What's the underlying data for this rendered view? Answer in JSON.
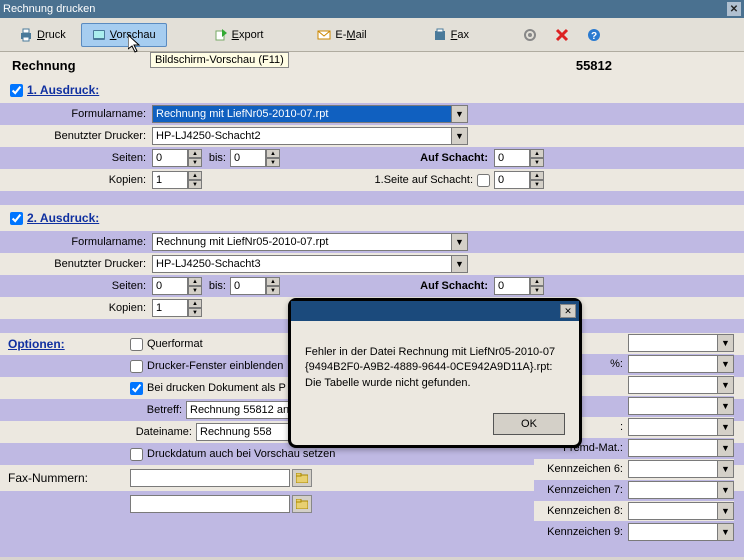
{
  "window": {
    "title": "Rechnung drucken"
  },
  "toolbar": {
    "druck": "Druck",
    "vorschau": "Vorschau",
    "export": "Export",
    "email": "E-Mail",
    "fax": "Fax"
  },
  "tooltip": "Bildschirm-Vorschau (F11)",
  "header": {
    "title": "Rechnung",
    "number": "55812"
  },
  "ausdruck1": {
    "heading": "1. Ausdruck:",
    "formularname_label": "Formularname:",
    "formularname": "Rechnung mit LiefNr05-2010-07.rpt",
    "drucker_label": "Benutzter Drucker:",
    "drucker": "HP-LJ4250-Schacht2",
    "seiten_label": "Seiten:",
    "seiten": "0",
    "bis_label": "bis:",
    "bis": "0",
    "auf_schacht_label": "Auf Schacht:",
    "auf_schacht": "0",
    "kopien_label": "Kopien:",
    "kopien": "1",
    "seite1_label": "1.Seite auf Schacht:",
    "seite1": "0"
  },
  "ausdruck2": {
    "heading": "2. Ausdruck:",
    "formularname_label": "Formularname:",
    "formularname": "Rechnung mit LiefNr05-2010-07.rpt",
    "drucker_label": "Benutzter Drucker:",
    "drucker": "HP-LJ4250-Schacht3",
    "seiten_label": "Seiten:",
    "seiten": "0",
    "bis_label": "bis:",
    "bis": "0",
    "auf_schacht_label": "Auf Schacht:",
    "auf_schacht": "0",
    "kopien_label": "Kopien:",
    "kopien": "1"
  },
  "optionen": {
    "heading": "Optionen:",
    "querformat": "Querformat",
    "drucker_fenster": "Drucker-Fenster einblenden",
    "bei_drucken": "Bei drucken Dokument als P",
    "betreff_label": "Betreff:",
    "betreff": "Rechnung 55812 an",
    "dateiname_label": "Dateiname:",
    "dateiname": "Rechnung 558",
    "druckdatum": "Druckdatum auch bei Vorschau setzen",
    "fax_label": "Fax-Nummern:"
  },
  "right": {
    "mwst": "%:",
    "fremd": "Fremd-Mat.:",
    "kz6": "Kennzeichen 6:",
    "kz7": "Kennzeichen 7:",
    "kz8": "Kennzeichen 8:",
    "kz9": "Kennzeichen 9:"
  },
  "error": {
    "line1": "Fehler in der Datei Rechnung mit LiefNr05-2010-07",
    "line2": "{9494B2F0-A9B2-4889-9644-0CE942A9D11A}.rpt:",
    "line3": "Die Tabelle wurde nicht gefunden.",
    "ok": "OK"
  }
}
